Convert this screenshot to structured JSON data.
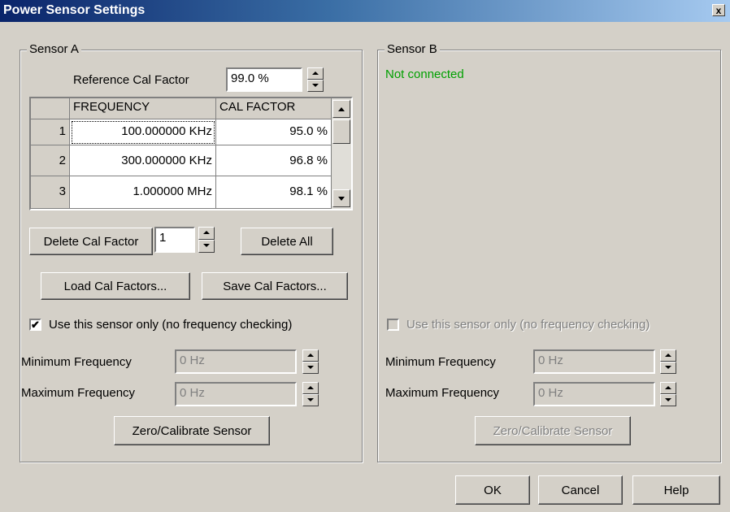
{
  "window": {
    "title": "Power Sensor Settings",
    "close_glyph": "x"
  },
  "sensor_a": {
    "legend": "Sensor A",
    "ref_cal_label": "Reference Cal Factor",
    "ref_cal_value": "99.0 %",
    "table": {
      "headers": [
        "FREQUENCY",
        "CAL FACTOR"
      ],
      "rows": [
        {
          "num": "1",
          "freq": "100.000000 KHz",
          "cal": "95.0 %"
        },
        {
          "num": "2",
          "freq": "300.000000 KHz",
          "cal": "96.8 %"
        },
        {
          "num": "3",
          "freq": "1.000000 MHz",
          "cal": "98.1 %"
        }
      ]
    },
    "delete_cal_label": "Delete Cal Factor",
    "delete_cal_index": "1",
    "delete_all_label": "Delete All",
    "load_label": "Load Cal Factors...",
    "save_label": "Save Cal Factors...",
    "use_only_label": "Use this sensor only (no frequency checking)",
    "use_only_checked": true,
    "min_freq_label": "Minimum Frequency",
    "min_freq_value": "0 Hz",
    "max_freq_label": "Maximum Frequency",
    "max_freq_value": "0 Hz",
    "zero_label": "Zero/Calibrate Sensor"
  },
  "sensor_b": {
    "legend": "Sensor B",
    "status": "Not connected",
    "status_color": "#00a000",
    "use_only_label": "Use this sensor only (no frequency checking)",
    "min_freq_label": "Minimum Frequency",
    "min_freq_value": "0 Hz",
    "max_freq_label": "Maximum Frequency",
    "max_freq_value": "0 Hz",
    "zero_label": "Zero/Calibrate Sensor"
  },
  "footer": {
    "ok": "OK",
    "cancel": "Cancel",
    "help": "Help"
  },
  "colors": {
    "face": "#d4d0c8",
    "title_start": "#0a246a",
    "title_end": "#a6caf0"
  }
}
